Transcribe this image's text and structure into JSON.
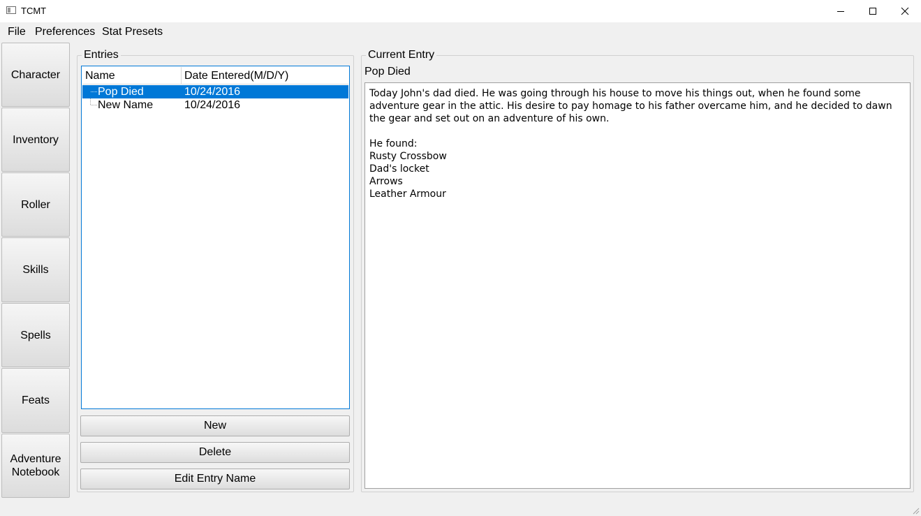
{
  "window": {
    "title": "TCMT",
    "icons": {
      "app": "window-app-icon",
      "minimize": "minimize-icon",
      "maximize": "maximize-icon",
      "close": "close-icon"
    }
  },
  "menu": [
    "File",
    "Preferences",
    "Stat Presets"
  ],
  "nav": [
    "Character",
    "Inventory",
    "Roller",
    "Skills",
    "Spells",
    "Feats",
    "Adventure\nNotebook"
  ],
  "entries": {
    "title": "Entries",
    "columns": [
      "Name",
      "Date Entered(M/D/Y)"
    ],
    "rows": [
      {
        "name": "Pop Died",
        "date": "10/24/2016",
        "selected": true
      },
      {
        "name": "New Name",
        "date": "10/24/2016",
        "selected": false
      }
    ],
    "buttons": {
      "new": "New",
      "delete": "Delete",
      "edit": "Edit Entry Name"
    }
  },
  "current": {
    "group_title": "Current Entry",
    "entry_name": "Pop Died",
    "text": "Today John's dad died. He was going through his house to move his things out, when he found some adventure gear in the attic. His desire to pay homage to his father overcame him, and he decided to dawn the gear and set out on an adventure of his own.\n\nHe found:\nRusty Crossbow\nDad's locket\nArrows\nLeather Armour"
  },
  "colors": {
    "selection": "#0078d7",
    "focus_border": "#0078d7",
    "background": "#f0f0f0"
  }
}
